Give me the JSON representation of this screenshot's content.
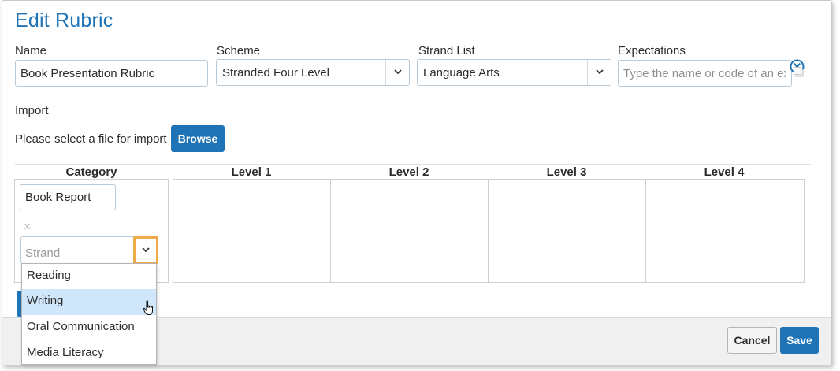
{
  "dialog": {
    "title": "Edit Rubric"
  },
  "form": {
    "name": {
      "label": "Name",
      "value": "Book Presentation Rubric"
    },
    "scheme": {
      "label": "Scheme",
      "value": "Stranded Four Level"
    },
    "strand_list": {
      "label": "Strand List",
      "value": "Language Arts"
    },
    "expectations": {
      "label": "Expectations",
      "placeholder": "Type the name or code of an expectation"
    }
  },
  "import": {
    "label": "Import",
    "prompt": "Please select a file for import",
    "browse_label": "Browse"
  },
  "rubric_table": {
    "headers": [
      "Category",
      "Level 1",
      "Level 2",
      "Level 3",
      "Level 4"
    ],
    "category_value": "Book Report",
    "remove_symbol": "×",
    "strand_placeholder": "Strand",
    "strand_options": [
      "Reading",
      "Writing",
      "Oral Communication",
      "Media Literacy"
    ],
    "highlighted_option": "Writing"
  },
  "footer": {
    "cancel_label": "Cancel",
    "save_label": "Save"
  },
  "colors": {
    "accent": "#1f74b8",
    "focus_outline": "#f0a94a",
    "highlight": "#cfe6fb"
  }
}
